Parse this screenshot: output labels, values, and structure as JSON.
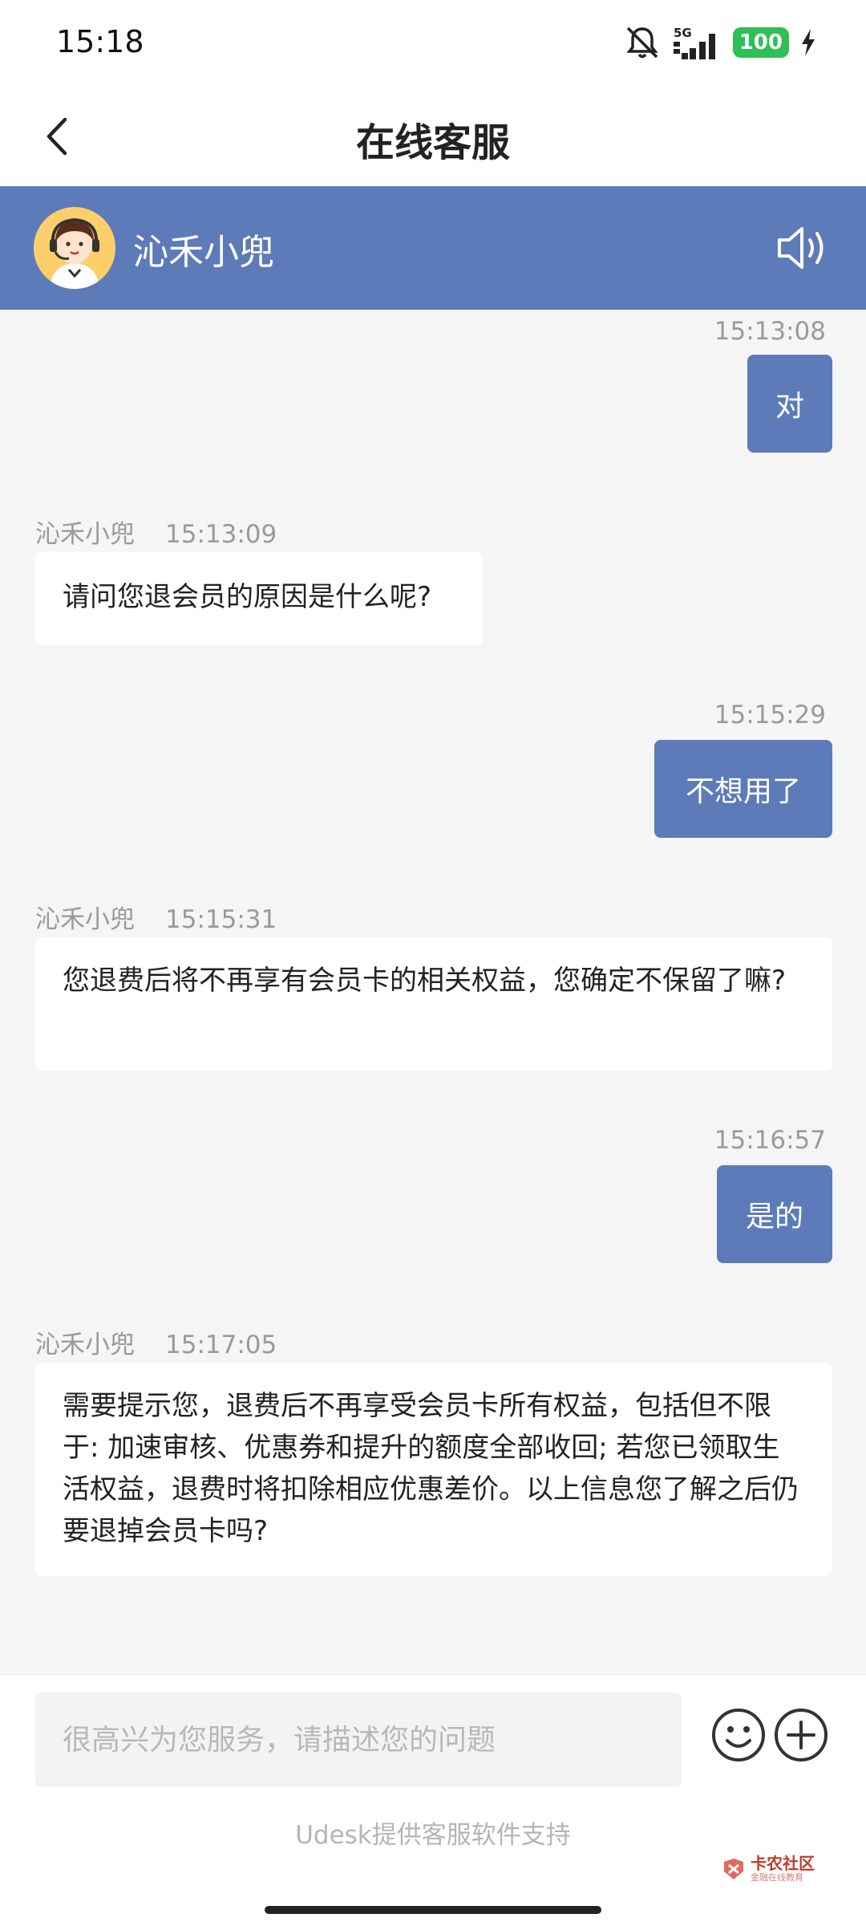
{
  "status_bar": {
    "time": "15:18",
    "network": "5G",
    "battery": "100"
  },
  "title_bar": {
    "title": "在线客服"
  },
  "agent": {
    "name": "沁禾小兜"
  },
  "messages": [
    {
      "from": "user",
      "time": "15:13:08",
      "text": "对"
    },
    {
      "from": "agent",
      "name": "沁禾小兜",
      "time": "15:13:09",
      "text": "请问您退会员的原因是什么呢?"
    },
    {
      "from": "user",
      "time": "15:15:29",
      "text": "不想用了"
    },
    {
      "from": "agent",
      "name": "沁禾小兜",
      "time": "15:15:31",
      "text": "您退费后将不再享有会员卡的相关权益，您确定不保留了嘛?"
    },
    {
      "from": "user",
      "time": "15:16:57",
      "text": "是的"
    },
    {
      "from": "agent",
      "name": "沁禾小兜",
      "time": "15:17:05",
      "text": "需要提示您，退费后不再享受会员卡所有权益，包括但不限于: 加速审核、优惠券和提升的额度全部收回; 若您已领取生活权益，退费时将扣除相应优惠差价。以上信息您了解之后仍要退掉会员卡吗?"
    }
  ],
  "input": {
    "placeholder": "很高兴为您服务，请描述您的问题",
    "value": ""
  },
  "footer": {
    "note": "Udesk提供客服软件支持"
  },
  "watermark": {
    "main": "卡农社区",
    "sub": "金融在线教育"
  },
  "colors": {
    "accent": "#5d7bb8",
    "background": "#f5f5f5",
    "battery": "#2fbf57"
  },
  "icons": [
    "back-chevron-icon",
    "speaker-icon",
    "emoji-icon",
    "plus-icon",
    "bell-off-icon",
    "signal-icon",
    "charging-bolt-icon"
  ]
}
